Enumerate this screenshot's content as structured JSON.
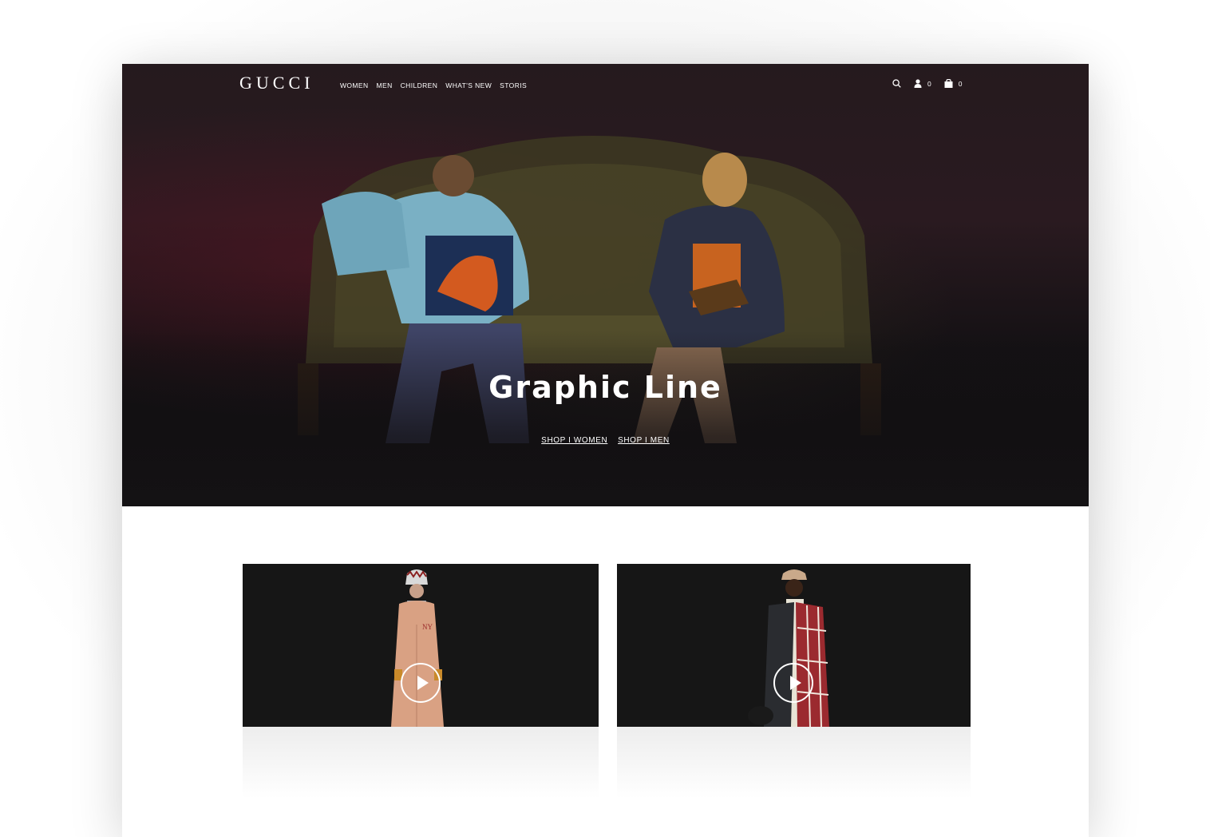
{
  "brand": {
    "logo_text": "GUCCI"
  },
  "nav": {
    "items": [
      {
        "label": "WOMEN"
      },
      {
        "label": "MEN"
      },
      {
        "label": "CHILDREN"
      },
      {
        "label": "WHAT'S NEW"
      },
      {
        "label": "STORIS"
      }
    ],
    "account_count": "0",
    "bag_count": "0"
  },
  "hero": {
    "title": "Graphic Line",
    "cta_women": "SHOP I WOMEN",
    "cta_men": "SHOP I MEN"
  },
  "icons": {
    "search": "search-icon",
    "account": "user-icon",
    "bag": "shopping-bag-icon",
    "play": "play-icon"
  },
  "colors": {
    "hero_bg": "#1b1417",
    "video_bg": "#161616",
    "text_light": "#ffffff"
  }
}
